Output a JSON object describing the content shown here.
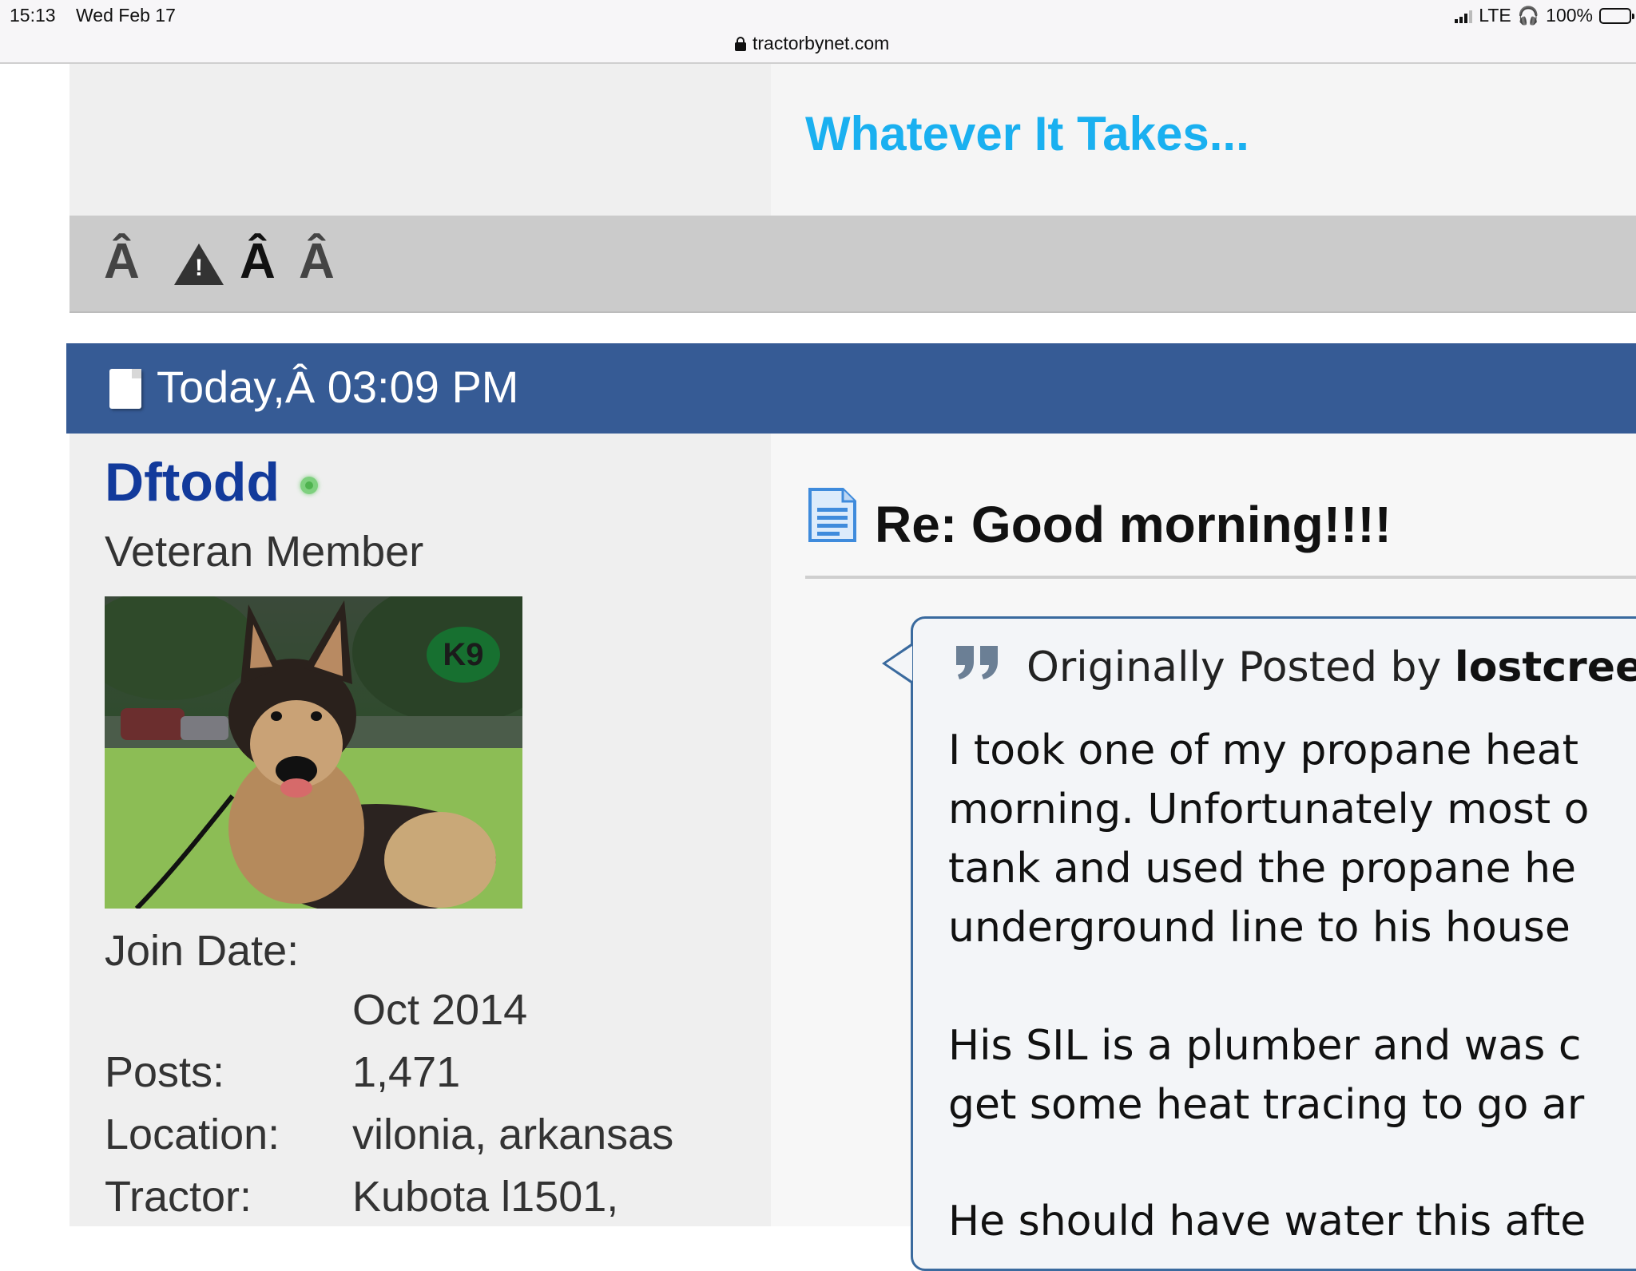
{
  "status_bar": {
    "time": "15:13",
    "date": "Wed Feb 17",
    "url": "tractorbynet.com",
    "network": "LTE",
    "battery": "100%"
  },
  "header": {
    "tagline": "Whatever It Takes...",
    "tagline_color": "#1ab0f0"
  },
  "toolbar": {
    "glyph_1": "Â",
    "glyph_2": "Â",
    "glyph_3": "Â"
  },
  "post_meta": {
    "date_label": "Today,Â 03:09 PM",
    "bar_color": "#365b95"
  },
  "user": {
    "name": "Dftodd",
    "title": "Veteran Member",
    "avatar_badge": "K9",
    "join_date_label": "Join Date:",
    "join_date": "Oct 2014",
    "posts_label": "Posts:",
    "posts": "1,471",
    "location_label": "Location:",
    "location": "vilonia, arkansas",
    "tractor_label": "Tractor:",
    "tractor": "Kubota l1501,"
  },
  "post": {
    "title": "Re: Good morning!!!!",
    "quote": {
      "prefix": "Originally Posted by",
      "author": "lostcree",
      "lines": [
        "I took one of my propane heat",
        "morning. Unfortunately most o",
        "tank and used the propane he",
        "underground line to his house",
        "His SIL is a plumber and was c",
        "get some heat tracing to go ar",
        "He should have water this afte"
      ]
    }
  }
}
